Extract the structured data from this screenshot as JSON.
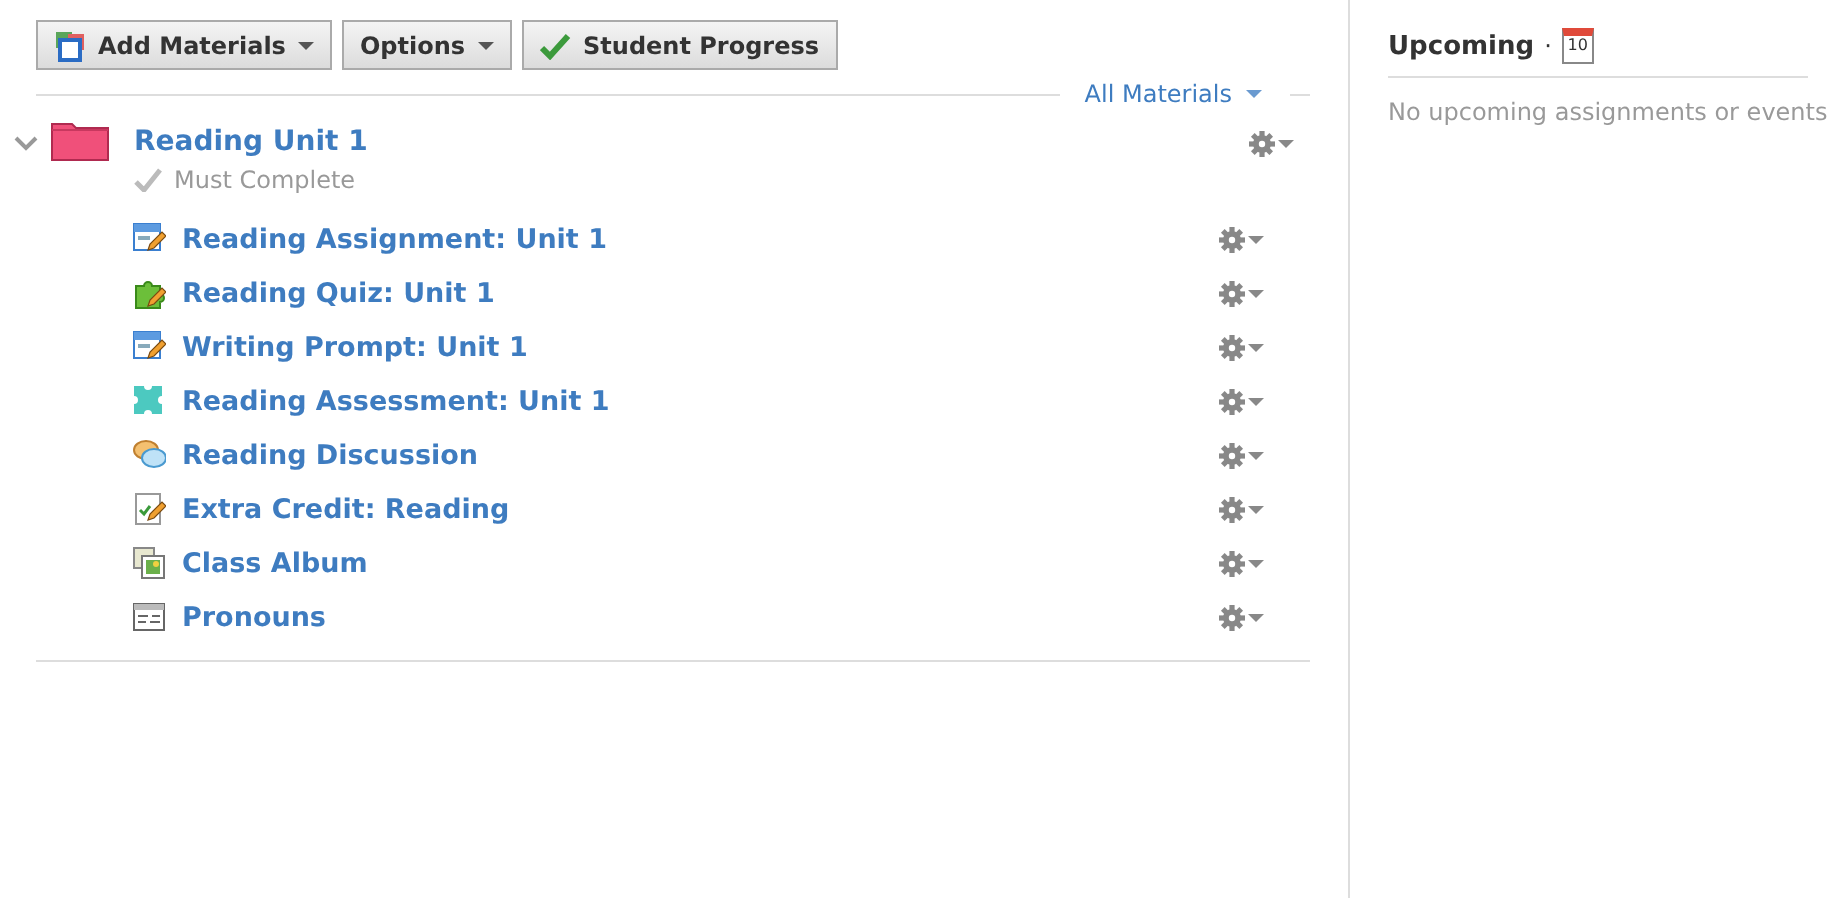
{
  "toolbar": [
    {
      "label": "Add Materials",
      "kind": "add",
      "dropdown": true
    },
    {
      "label": "Options",
      "kind": "plain",
      "dropdown": true
    },
    {
      "label": "Student Progress",
      "kind": "check",
      "dropdown": false
    }
  ],
  "filter": {
    "label": "All Materials"
  },
  "folder": {
    "title": "Reading Unit 1",
    "expanded": true,
    "requirement": "Must Complete",
    "children": [
      {
        "title": "Reading Assignment: Unit 1",
        "kind": "assignment"
      },
      {
        "title": "Reading Quiz: Unit 1",
        "kind": "quiz"
      },
      {
        "title": "Writing Prompt: Unit 1",
        "kind": "assignment"
      },
      {
        "title": "Reading Assessment: Unit 1",
        "kind": "assessment"
      },
      {
        "title": "Reading Discussion",
        "kind": "discussion"
      },
      {
        "title": "Extra Credit: Reading",
        "kind": "checklist"
      },
      {
        "title": "Class Album",
        "kind": "album"
      },
      {
        "title": "Pronouns",
        "kind": "page"
      }
    ]
  },
  "upcoming": {
    "title": "Upcoming",
    "separator": "·",
    "calendar_day": "10",
    "empty_text": "No upcoming assignments or events"
  }
}
